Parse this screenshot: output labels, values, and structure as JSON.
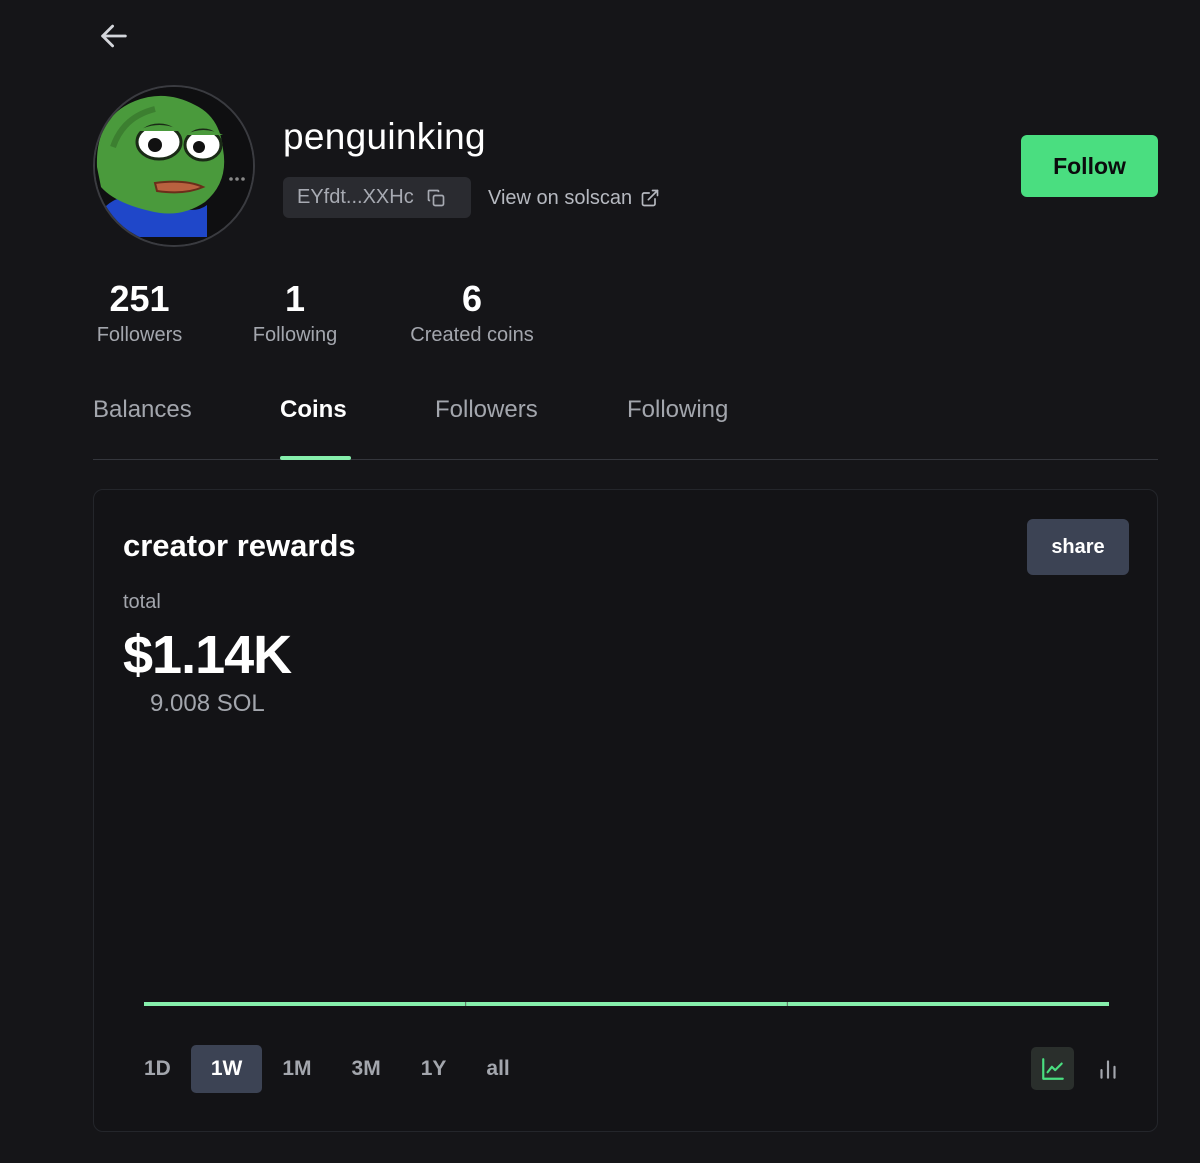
{
  "profile": {
    "username": "penguinking",
    "address": "EYfdt...XXHc",
    "solscan_label": "View on solscan",
    "follow_label": "Follow"
  },
  "stats": [
    {
      "value": "251",
      "label": "Followers"
    },
    {
      "value": "1",
      "label": "Following"
    },
    {
      "value": "6",
      "label": "Created coins"
    }
  ],
  "tabs": [
    {
      "label": "Balances",
      "active": false
    },
    {
      "label": "Coins",
      "active": true
    },
    {
      "label": "Followers",
      "active": false
    },
    {
      "label": "Following",
      "active": false
    }
  ],
  "rewards": {
    "title": "creator rewards",
    "share_label": "share",
    "total_label": "total",
    "total_usd": "$1.14K",
    "total_sol": "9.008 SOL",
    "ranges": [
      "1D",
      "1W",
      "1M",
      "3M",
      "1Y",
      "all"
    ],
    "active_range": "1W",
    "active_view": "line-chart"
  },
  "colors": {
    "accent": "#4ade80",
    "chart_line": "#86efac",
    "background": "#151518",
    "chip": "#2a2b30",
    "button_secondary": "#3c4354"
  },
  "icons": {
    "back": "arrow-left-icon",
    "copy": "copy-icon",
    "external": "external-link-icon",
    "line_view": "line-chart-icon",
    "bar_view": "bar-chart-icon"
  },
  "chart_data": {
    "type": "line",
    "x": [
      0,
      1,
      2,
      3
    ],
    "series": [
      {
        "values": [
          0,
          0,
          0,
          0
        ]
      }
    ],
    "title": "",
    "xlabel": "",
    "ylabel": ""
  }
}
